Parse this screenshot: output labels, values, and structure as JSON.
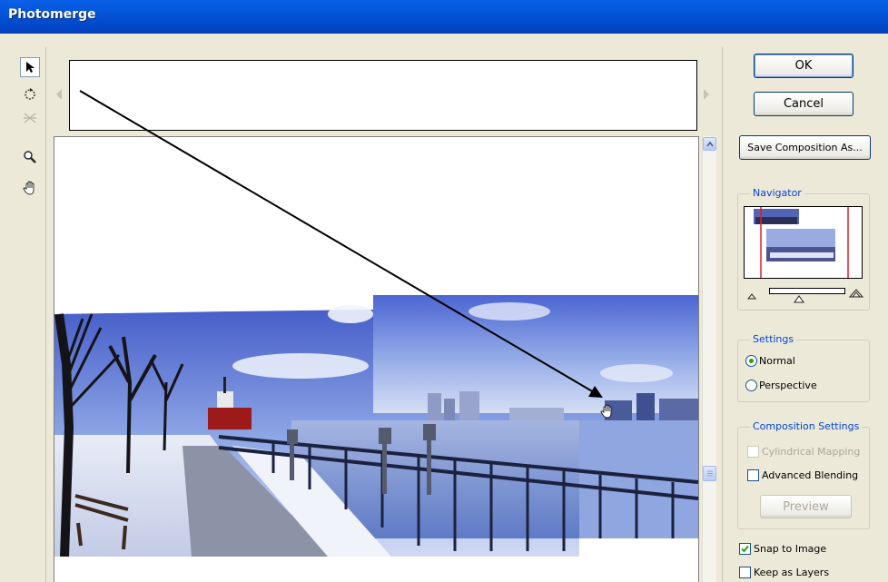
{
  "window": {
    "title": "Photomerge"
  },
  "tools": [
    "select-image-tool",
    "rotate-image-tool",
    "vanishing-point-tool",
    "zoom-tool",
    "hand-tool"
  ],
  "buttons": {
    "ok": "OK",
    "cancel": "Cancel",
    "save_composition": "Save Composition As..."
  },
  "navigator": {
    "label": "Navigator"
  },
  "settings": {
    "label": "Settings",
    "options": [
      "Normal",
      "Perspective"
    ],
    "selected": "Normal"
  },
  "composition_settings": {
    "label": "Composition Settings",
    "cylindrical": "Cylindrical Mapping",
    "advanced_blending": "Advanced Blending",
    "preview": "Preview"
  },
  "snap_to_image": {
    "label": "Snap to Image",
    "checked": true
  },
  "keep_as_layers": {
    "label": "Keep as Layers",
    "checked": false
  },
  "colors": {
    "title_bar": "#0453D6",
    "dialog_bg": "#ECE9D8",
    "group_label": "#0046D5",
    "navigator_view_box": "#E02020"
  }
}
